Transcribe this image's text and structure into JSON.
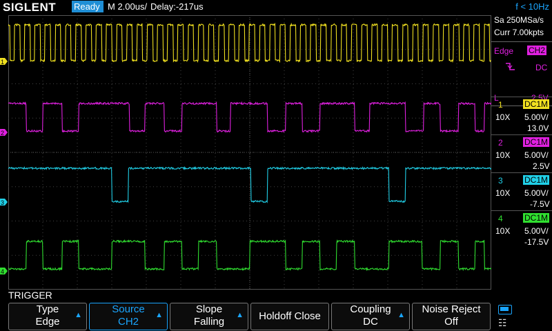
{
  "header": {
    "brand": "SIGLENT",
    "status": "Ready",
    "timebase": "M 2.00us/",
    "delay": "Delay:-217us",
    "frequency": "f < 10Hz"
  },
  "acquisition": {
    "sample_rate": "Sa 250MSa/s",
    "memory": "Curr 7.00kpts"
  },
  "trigger_info": {
    "type_label": "Edge",
    "source_badge": "CH2",
    "coupling": "DC",
    "level_label": "L",
    "level_value": "2.5V"
  },
  "channels": [
    {
      "number": "1",
      "coupling": "DC1M",
      "probe": "10X",
      "volts_div": "5.00V/",
      "offset": "13.0V",
      "color": "#f0e020"
    },
    {
      "number": "2",
      "coupling": "DC1M",
      "probe": "10X",
      "volts_div": "5.00V/",
      "offset": "2.5V",
      "color": "#e020e0"
    },
    {
      "number": "3",
      "coupling": "DC1M",
      "probe": "10X",
      "volts_div": "5.00V/",
      "offset": "-7.5V",
      "color": "#20d0e8"
    },
    {
      "number": "4",
      "coupling": "DC1M",
      "probe": "10X",
      "volts_div": "5.00V/",
      "offset": "-17.5V",
      "color": "#30e030"
    }
  ],
  "menu": {
    "title": "TRIGGER",
    "items": [
      {
        "line1": "Type",
        "line2": "Edge"
      },
      {
        "line1": "Source",
        "line2": "CH2"
      },
      {
        "line1": "Slope",
        "line2": "Falling"
      },
      {
        "line1": "Holdoff Close",
        "line2": ""
      },
      {
        "line1": "Coupling",
        "line2": "DC"
      },
      {
        "line1": "Noise Reject",
        "line2": "Off"
      }
    ]
  },
  "icons": {
    "usb": "usb-icon",
    "network": "network-icon",
    "slope": "falling-edge-icon",
    "trigger_pos": "trigger-position-icon"
  }
}
